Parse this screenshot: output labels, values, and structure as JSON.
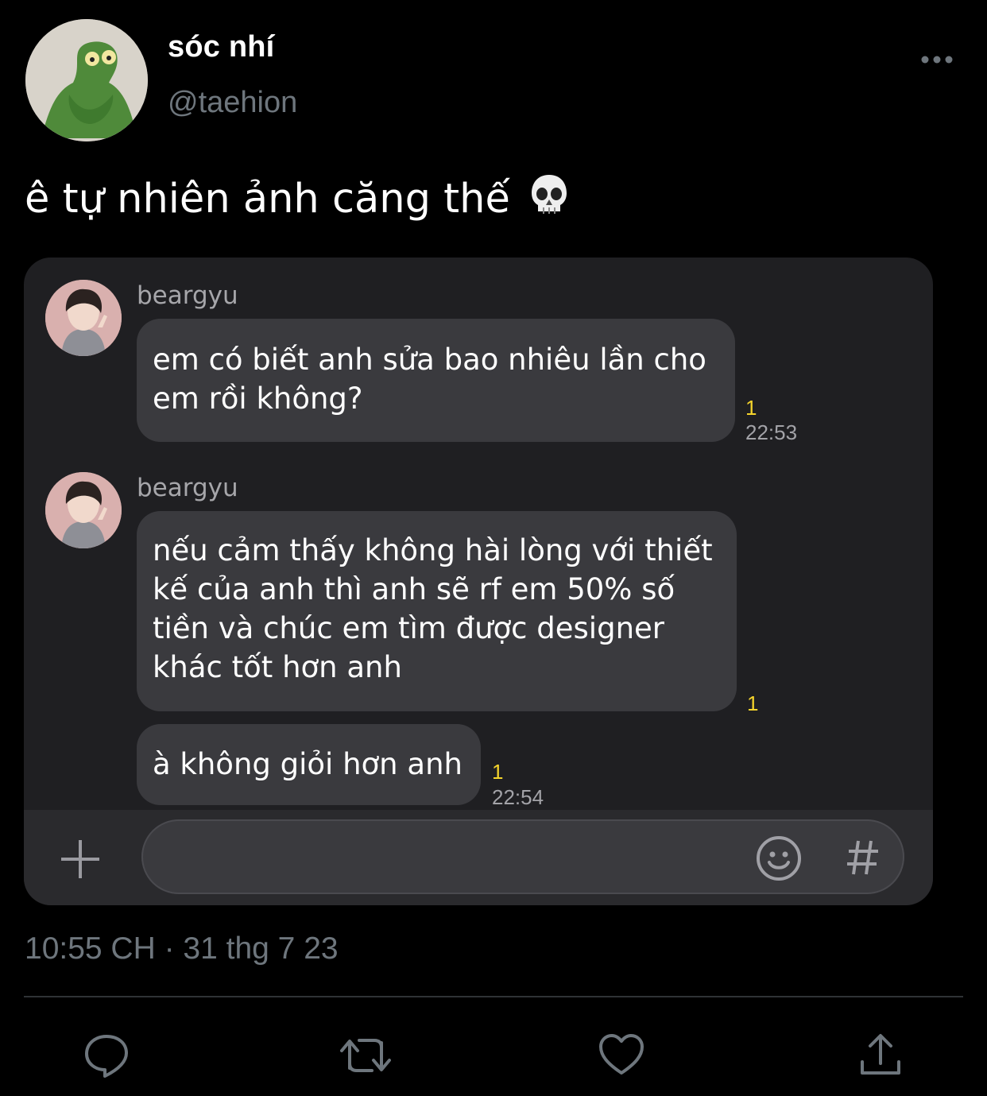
{
  "tweet": {
    "display_name": "sóc nhí",
    "handle": "@taehion",
    "text": "ê tự nhiên ảnh căng thế",
    "emoji_icon": "skull-icon",
    "timestamp": "10:55 CH · 31 thg 7 23"
  },
  "chat": {
    "messages": [
      {
        "sender": "beargyu",
        "text_lines": [
          "em có biết anh sửa bao nhiêu lần cho",
          "em rồi không?"
        ],
        "unread": "1",
        "time": "22:53"
      },
      {
        "sender": "beargyu",
        "text_lines": [
          "nếu cảm thấy không hài lòng với thiết",
          "kế của anh thì anh sẽ rf em 50% số",
          "tiền và chúc em tìm được designer",
          "khác tốt hơn anh"
        ],
        "unread": "1"
      },
      {
        "text_lines": [
          "à không giỏi hơn anh"
        ],
        "unread": "1",
        "time": "22:54"
      }
    ],
    "input": {
      "add_icon": "plus-icon",
      "emoji_icon": "smiley-icon",
      "hashtag_icon": "hash-icon"
    }
  },
  "actions": [
    "reply-icon",
    "retweet-icon",
    "like-icon",
    "share-icon"
  ],
  "colors": {
    "background": "#000000",
    "card": "#1f1f22",
    "bubble": "#3a3a3e",
    "muted_text": "#6e767d",
    "unread_yellow": "#f5d42c"
  }
}
